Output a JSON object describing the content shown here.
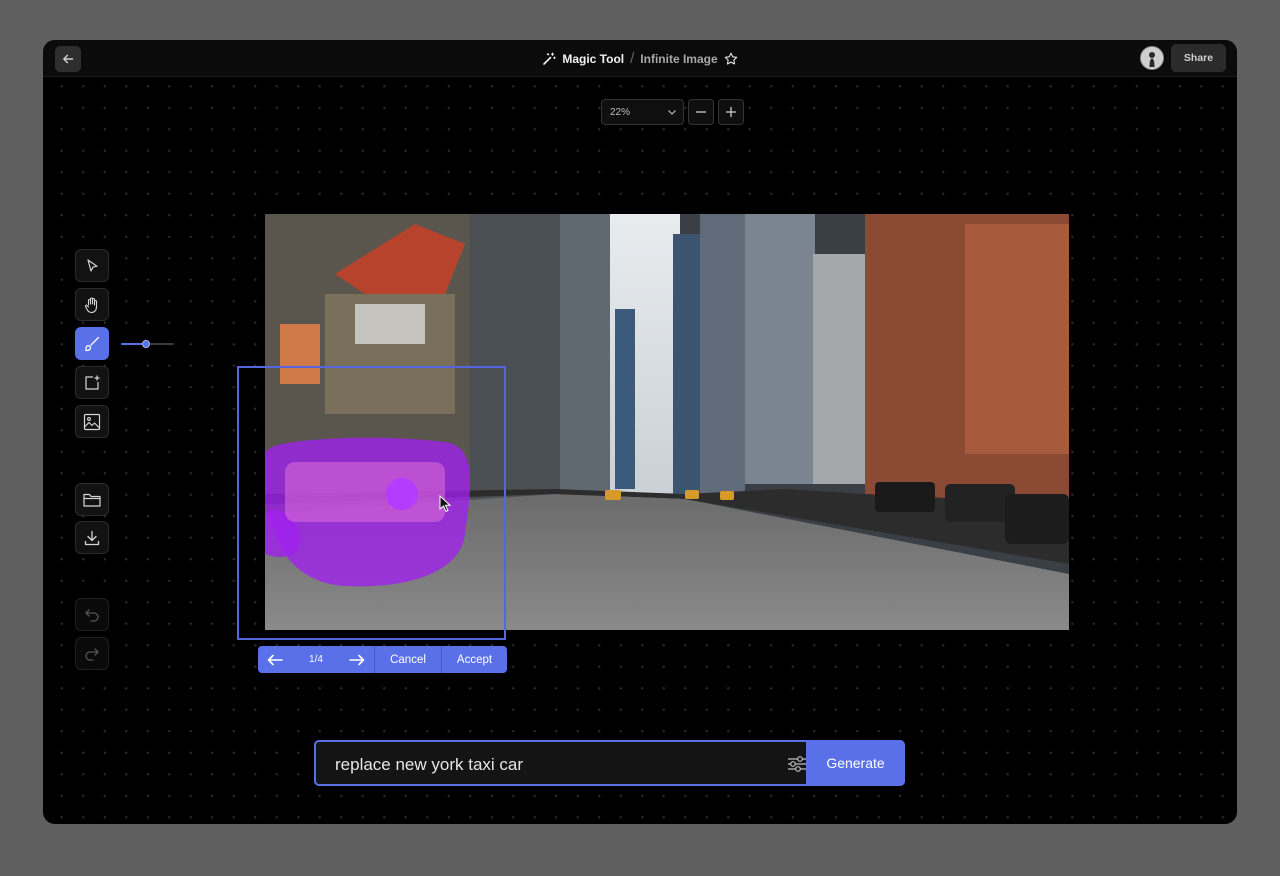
{
  "header": {
    "app_name": "Magic Tool",
    "separator": "/",
    "page_name": "Infinite Image",
    "share_label": "Share",
    "icons": {
      "back": "arrow-left-icon",
      "app": "magic-wand-icon",
      "favorite": "star-icon",
      "avatar": "user-avatar"
    }
  },
  "zoom": {
    "value": "22%",
    "icons": [
      "chevron-down-icon",
      "minus-icon",
      "plus-icon"
    ]
  },
  "toolbar": {
    "tools": [
      "select-pointer",
      "hand-pan",
      "brush",
      "add-frame",
      "image",
      "open-folder",
      "download",
      "undo",
      "redo"
    ],
    "active_tool": "brush",
    "disabled_tools": [
      "undo",
      "redo"
    ],
    "brush_size_fraction": 0.48
  },
  "variations": {
    "counter": "1/4",
    "cancel_label": "Cancel",
    "accept_label": "Accept"
  },
  "prompt": {
    "value": "replace new york taxi car",
    "generate_label": "Generate",
    "settings_icon": "sliders-icon"
  },
  "colors": {
    "accent": "#5a70e8",
    "mask": "#a020f0",
    "selection": "#5566e0"
  }
}
